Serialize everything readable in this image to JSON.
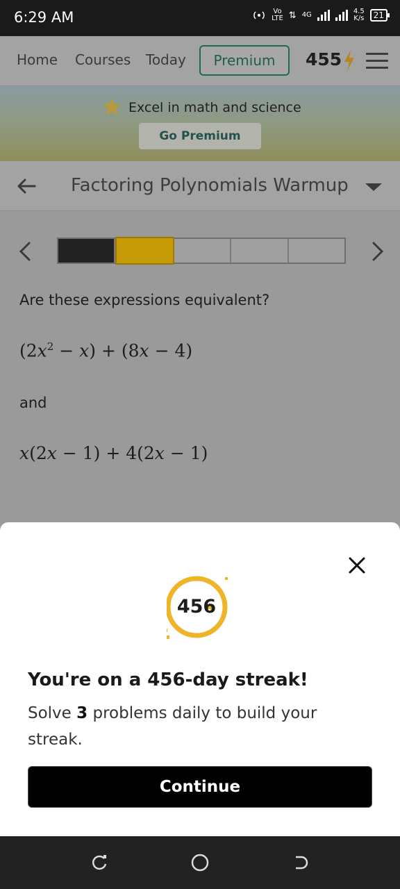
{
  "status_bar": {
    "time": "6:29 AM",
    "network_top": "Vo",
    "network_bottom": "LTE",
    "network_gen": "4G",
    "speed_top": "4.5",
    "speed_bottom": "K/s",
    "battery": "21"
  },
  "topnav": {
    "links": [
      "Home",
      "Courses",
      "Today"
    ],
    "premium_label": "Premium",
    "streak_count": "455",
    "accent_color": "#e3a20a"
  },
  "banner": {
    "text": "Excel in math and science",
    "button_label": "Go Premium"
  },
  "lesson": {
    "title": "Factoring Polynomials Warmup",
    "progress": {
      "total_steps": 5,
      "completed": 1,
      "current_index": 1
    }
  },
  "problem": {
    "question": "Are these expressions equivalent?",
    "and_label": "and"
  },
  "modal": {
    "streak_number": "456",
    "headline": "You're on a 456-day streak!",
    "desc_prefix": "Solve ",
    "desc_bold": "3",
    "desc_suffix": " problems daily to build your streak.",
    "continue_label": "Continue"
  }
}
